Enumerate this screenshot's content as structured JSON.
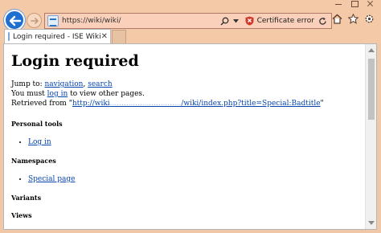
{
  "browser": {
    "address": {
      "url": "https://wiki/wiki/",
      "certificate_status": "Certificate error"
    },
    "tab": {
      "title": "Login required - ISE Wiki",
      "close_glyph": "✕"
    }
  },
  "page": {
    "heading": "Login required",
    "jump_to_prefix": "Jump to: ",
    "jump_nav": "navigation",
    "jump_sep": ", ",
    "jump_search": "search",
    "must_prefix": "You must ",
    "login_link": "log in",
    "must_suffix": " to view other pages.",
    "retrieved_prefix": "Retrieved from \"",
    "retrieved_url_start": "http://wiki",
    "retrieved_url_blur": "...............................",
    "retrieved_url_end": "/wiki/index.php?title=Special:Badtitle",
    "retrieved_suffix": "\"",
    "sections": {
      "personal_tools": "Personal tools",
      "login_item": "Log in",
      "namespaces": "Namespaces",
      "special_page_item": "Special page",
      "variants": "Variants",
      "views": "Views"
    }
  },
  "colors": {
    "chrome": "#f3c9a7",
    "address_bar": "#fbd0ba",
    "link": "#0645ad",
    "cert_error": "#d03a2a",
    "back_button": "#1e6fd0"
  },
  "icons": {
    "back": "arrow-left-icon",
    "forward": "arrow-right-icon",
    "search": "search-icon",
    "dropdown": "chevron-down-icon",
    "cert": "shield-error-icon",
    "refresh": "refresh-icon",
    "home": "home-icon",
    "favorites": "star-icon",
    "settings": "gear-icon"
  }
}
